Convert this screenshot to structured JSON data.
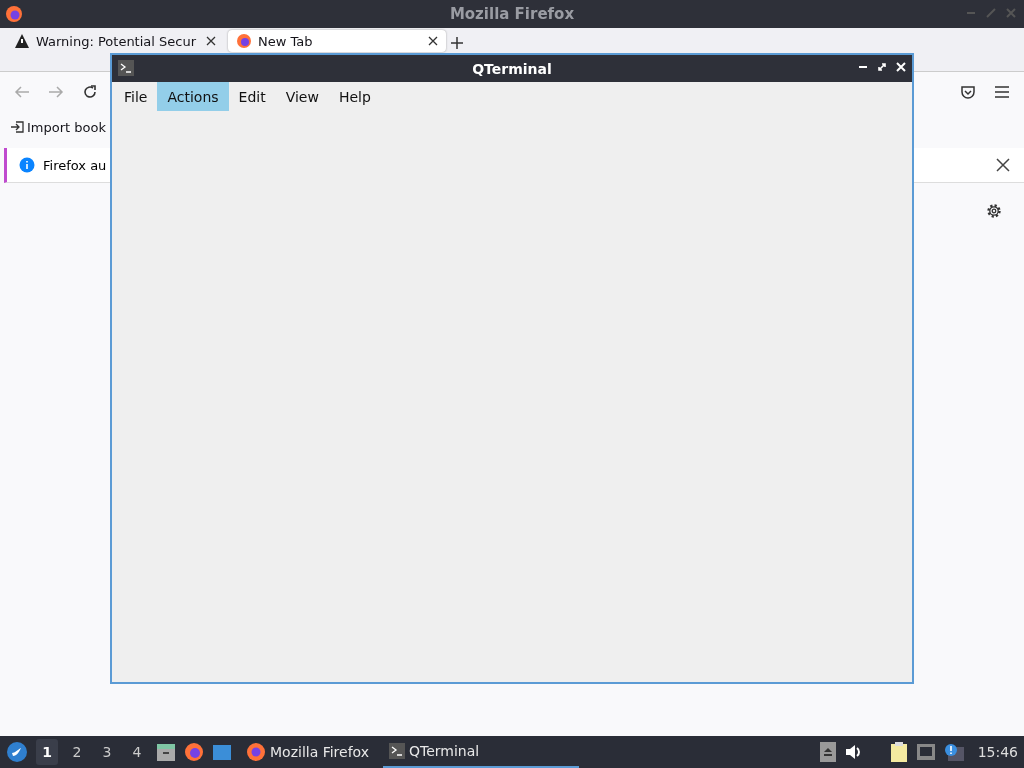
{
  "firefox": {
    "title": "Mozilla Firefox",
    "tabs": [
      {
        "label": "Warning: Potential Secur",
        "selected": false
      },
      {
        "label": "New Tab",
        "selected": true
      }
    ],
    "bookmarks": [
      "Import book"
    ],
    "notification": "Firefox au"
  },
  "terminal": {
    "title": "QTerminal",
    "menu": [
      {
        "label": "File",
        "selected": false
      },
      {
        "label": "Actions",
        "selected": true
      },
      {
        "label": "Edit",
        "selected": false
      },
      {
        "label": "View",
        "selected": false
      },
      {
        "label": "Help",
        "selected": false
      }
    ]
  },
  "taskbar": {
    "workspaces": [
      {
        "label": "1",
        "selected": true
      },
      {
        "label": "2",
        "selected": false
      },
      {
        "label": "3",
        "selected": false
      },
      {
        "label": "4",
        "selected": false
      }
    ],
    "tasks": [
      {
        "label": "Mozilla Firefox",
        "kind": "firefox",
        "selected": false
      },
      {
        "label": "QTerminal",
        "kind": "terminal",
        "selected": true
      }
    ],
    "clock": "15:46"
  }
}
